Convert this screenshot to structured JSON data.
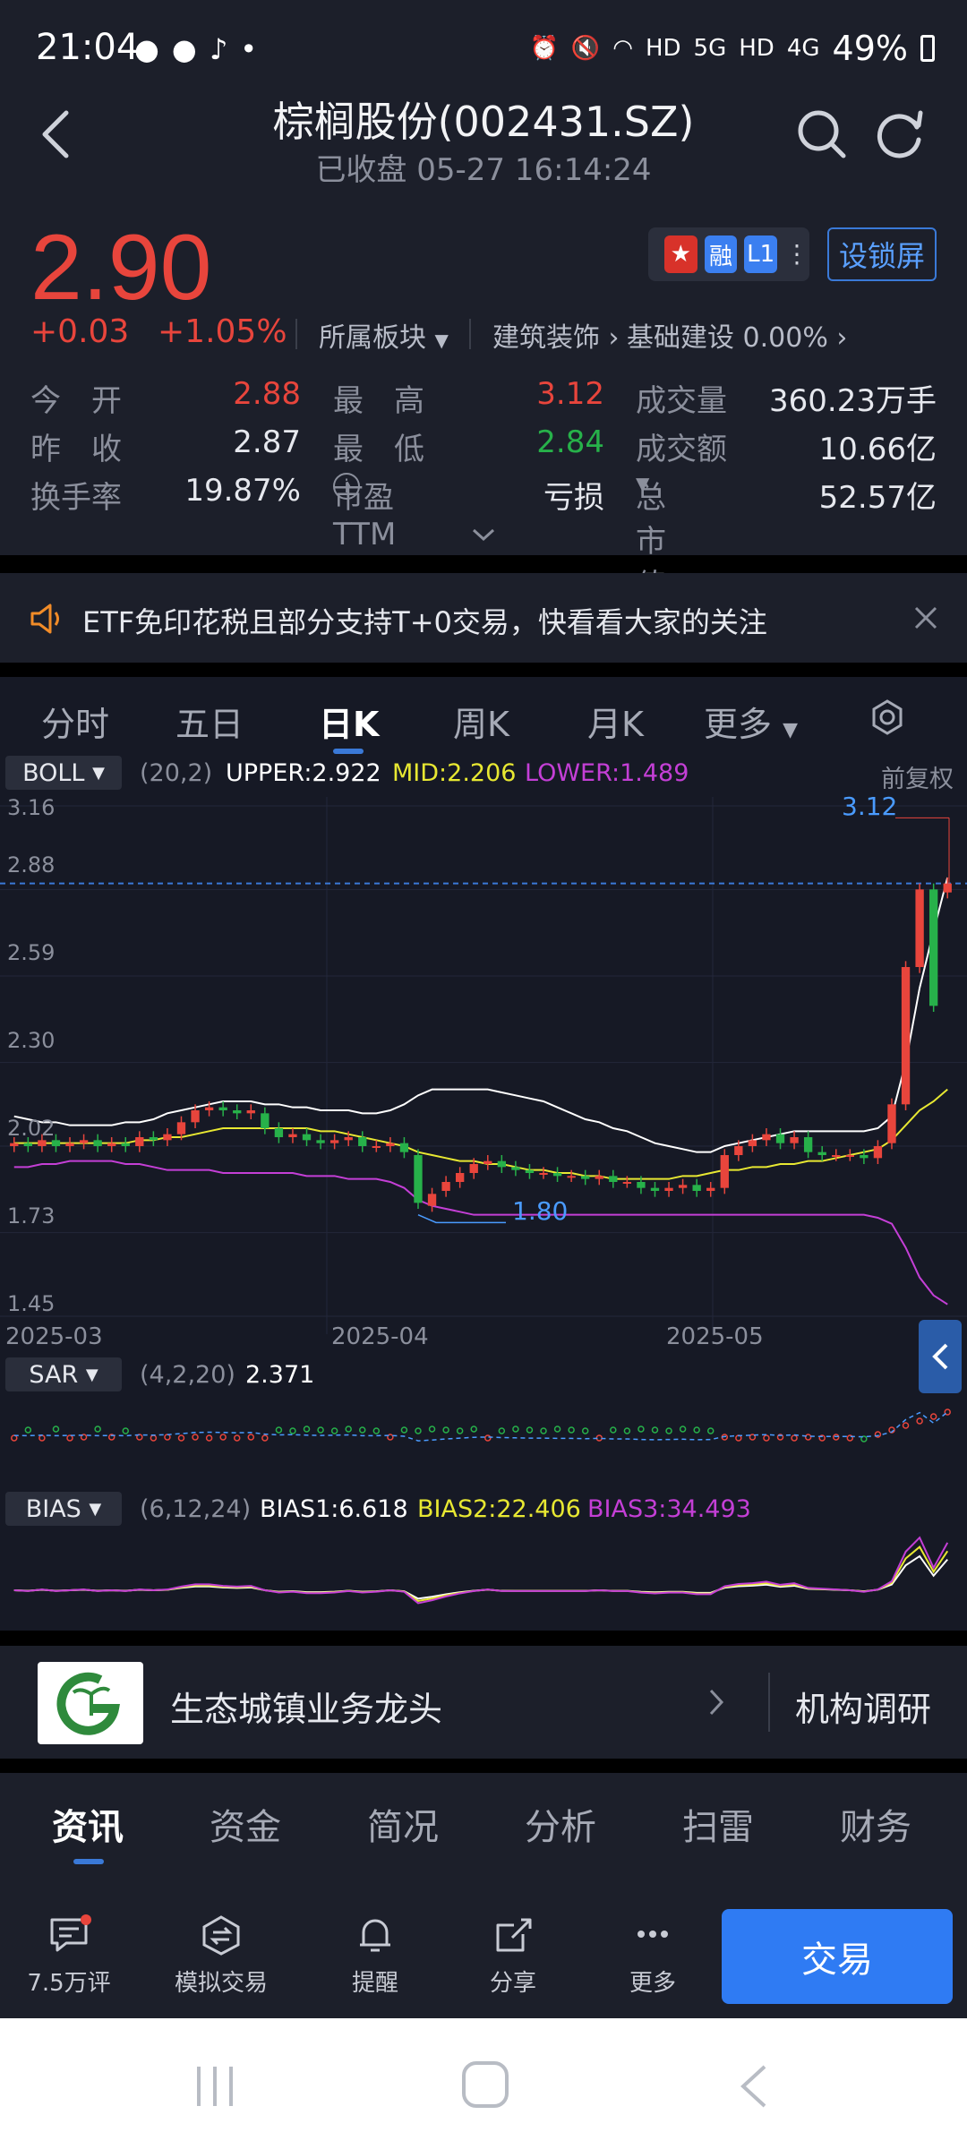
{
  "status_bar": {
    "time": "21:04",
    "battery": "49%",
    "net_labels": [
      "HD",
      "5G",
      "HD",
      "4G"
    ]
  },
  "header": {
    "title": "棕榈股份(002431.SZ)",
    "subtitle": "已收盘 05-27 16:14:24"
  },
  "quote": {
    "price": "2.90",
    "change": "+0.03",
    "change_pct": "+1.05%",
    "sector_label": "所属板块",
    "industry": "建筑装饰",
    "concept": "基础建设 0.00%",
    "badges": [
      "融",
      "L1"
    ],
    "lock_button": "设锁屏",
    "stats": [
      [
        "今　开",
        "2.88",
        "最　高",
        "3.12",
        "成交量",
        "360.23万手"
      ],
      [
        "昨　收",
        "2.87",
        "最　低",
        "2.84",
        "成交额",
        "10.66亿"
      ],
      [
        "换手率",
        "19.87%",
        "市盈TTM",
        "亏损",
        "总市值",
        "52.57亿"
      ]
    ],
    "colors": {
      "up": "#e8453c",
      "down": "#27b14a",
      "accent": "#2f7bf3"
    }
  },
  "notice": {
    "text": "ETF免印花税且部分支持T+0交易，快看看大家的关注"
  },
  "chart": {
    "tabs": [
      "分时",
      "五日",
      "日K",
      "周K",
      "月K",
      "更多"
    ],
    "active_tab": "日K",
    "boll": {
      "name": "BOLL",
      "params": "(20,2)",
      "upper": "UPPER:2.922",
      "mid": "MID:2.206",
      "lower": "LOWER:1.489",
      "adjust": "前复权"
    },
    "y_ticks": [
      "3.16",
      "2.88",
      "2.59",
      "2.30",
      "2.02",
      "1.73",
      "1.45"
    ],
    "x_ticks": [
      "2025-03",
      "2025-04",
      "2025-05"
    ],
    "high_marker": "3.12",
    "low_marker": "1.80",
    "sar": {
      "name": "SAR",
      "params": "(4,2,20)",
      "value": "2.371"
    },
    "bias": {
      "name": "BIAS",
      "params": "(6,12,24)",
      "b1": "BIAS1:6.618",
      "b2": "BIAS2:22.406",
      "b3": "BIAS3:34.493"
    }
  },
  "chart_data": {
    "type": "candlestick",
    "x_ticks": [
      "2025-03",
      "2025-04",
      "2025-05"
    ],
    "ylim": [
      1.45,
      3.16
    ],
    "last_close": 2.9,
    "high": 3.12,
    "low_marker": 1.8,
    "closes": [
      2.03,
      2.02,
      2.04,
      2.02,
      2.03,
      2.04,
      2.02,
      2.03,
      2.02,
      2.05,
      2.04,
      2.06,
      2.1,
      2.14,
      2.15,
      2.14,
      2.13,
      2.14,
      2.08,
      2.05,
      2.06,
      2.04,
      2.03,
      2.04,
      2.05,
      2.02,
      2.02,
      2.03,
      2.0,
      1.83,
      1.86,
      1.9,
      1.93,
      1.96,
      1.97,
      1.95,
      1.94,
      1.93,
      1.93,
      1.92,
      1.92,
      1.91,
      1.92,
      1.9,
      1.9,
      1.88,
      1.87,
      1.88,
      1.89,
      1.87,
      1.88,
      1.99,
      2.02,
      2.04,
      2.06,
      2.03,
      2.05,
      2.0,
      1.99,
      1.99,
      1.99,
      1.98,
      2.02,
      2.16,
      2.62,
      2.88,
      2.49,
      2.9
    ],
    "opens": [
      2.02,
      2.03,
      2.02,
      2.04,
      2.02,
      2.03,
      2.04,
      2.02,
      2.03,
      2.02,
      2.05,
      2.04,
      2.06,
      2.1,
      2.14,
      2.15,
      2.14,
      2.13,
      2.13,
      2.08,
      2.05,
      2.06,
      2.04,
      2.03,
      2.04,
      2.05,
      2.02,
      2.02,
      2.03,
      1.99,
      1.82,
      1.87,
      1.9,
      1.93,
      1.96,
      1.97,
      1.95,
      1.94,
      1.93,
      1.93,
      1.92,
      1.92,
      1.91,
      1.92,
      1.9,
      1.9,
      1.88,
      1.87,
      1.88,
      1.89,
      1.87,
      1.88,
      1.99,
      2.02,
      2.04,
      2.06,
      2.03,
      2.05,
      2.0,
      1.99,
      1.99,
      1.99,
      1.98,
      2.03,
      2.16,
      2.62,
      2.88,
      2.87
    ],
    "boll_upper": [
      2.12,
      2.11,
      2.1,
      2.1,
      2.09,
      2.09,
      2.09,
      2.09,
      2.1,
      2.1,
      2.11,
      2.13,
      2.14,
      2.15,
      2.16,
      2.17,
      2.17,
      2.17,
      2.16,
      2.16,
      2.15,
      2.15,
      2.14,
      2.14,
      2.14,
      2.13,
      2.13,
      2.14,
      2.16,
      2.19,
      2.21,
      2.21,
      2.21,
      2.21,
      2.21,
      2.2,
      2.19,
      2.18,
      2.17,
      2.15,
      2.13,
      2.11,
      2.1,
      2.08,
      2.07,
      2.05,
      2.03,
      2.02,
      2.01,
      2.0,
      2.0,
      2.02,
      2.03,
      2.04,
      2.05,
      2.06,
      2.07,
      2.07,
      2.07,
      2.07,
      2.07,
      2.07,
      2.08,
      2.12,
      2.3,
      2.55,
      2.74,
      2.92
    ],
    "boll_mid": [
      2.03,
      2.03,
      2.03,
      2.03,
      2.03,
      2.03,
      2.03,
      2.03,
      2.03,
      2.04,
      2.04,
      2.05,
      2.05,
      2.06,
      2.07,
      2.08,
      2.08,
      2.08,
      2.08,
      2.08,
      2.08,
      2.08,
      2.07,
      2.07,
      2.06,
      2.05,
      2.04,
      2.03,
      2.02,
      2.0,
      1.99,
      1.98,
      1.97,
      1.97,
      1.96,
      1.96,
      1.95,
      1.94,
      1.94,
      1.93,
      1.93,
      1.92,
      1.92,
      1.91,
      1.91,
      1.91,
      1.91,
      1.91,
      1.92,
      1.92,
      1.93,
      1.94,
      1.94,
      1.95,
      1.95,
      1.96,
      1.96,
      1.97,
      1.97,
      1.98,
      1.99,
      2.0,
      2.01,
      2.04,
      2.09,
      2.14,
      2.17,
      2.21
    ],
    "boll_lower": [
      1.95,
      1.95,
      1.96,
      1.96,
      1.97,
      1.97,
      1.97,
      1.97,
      1.96,
      1.96,
      1.95,
      1.94,
      1.94,
      1.94,
      1.94,
      1.93,
      1.93,
      1.93,
      1.93,
      1.93,
      1.93,
      1.92,
      1.92,
      1.92,
      1.91,
      1.91,
      1.91,
      1.9,
      1.88,
      1.84,
      1.82,
      1.81,
      1.8,
      1.79,
      1.79,
      1.79,
      1.79,
      1.79,
      1.79,
      1.79,
      1.79,
      1.79,
      1.79,
      1.79,
      1.79,
      1.79,
      1.79,
      1.79,
      1.79,
      1.79,
      1.79,
      1.79,
      1.79,
      1.79,
      1.79,
      1.79,
      1.79,
      1.79,
      1.79,
      1.79,
      1.79,
      1.79,
      1.78,
      1.76,
      1.68,
      1.58,
      1.52,
      1.49
    ]
  },
  "concept_bar": {
    "text": "生态城镇业务龙头",
    "right": "机构调研"
  },
  "info_tabs": [
    "资讯",
    "资金",
    "简况",
    "分析",
    "扫雷",
    "财务"
  ],
  "bottom_bar": {
    "items": [
      "7.5万评",
      "模拟交易",
      "提醒",
      "分享",
      "更多"
    ],
    "trade": "交易"
  }
}
